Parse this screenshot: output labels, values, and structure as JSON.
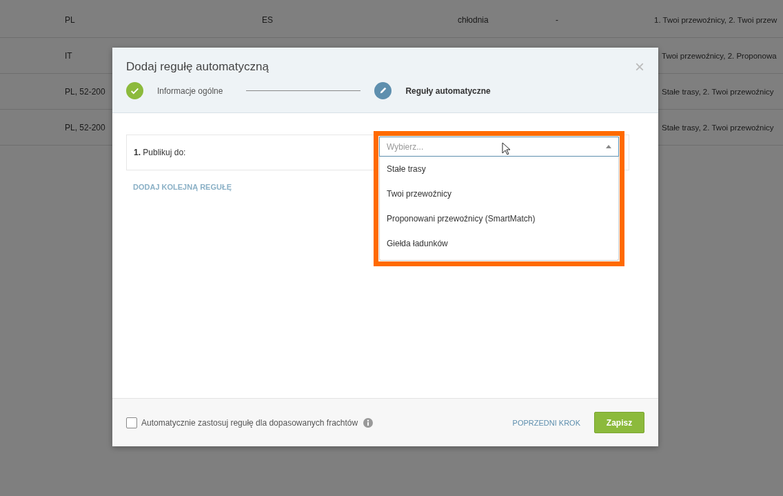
{
  "background_table": {
    "rows": [
      {
        "column_1": "PL",
        "column_2": "ES",
        "column_3": "chłodnia",
        "column_4": "-",
        "column_5": "1. Twoi przewoźnicy, 2. Twoi przew"
      },
      {
        "column_1": "IT",
        "column_5": "Twoi przewoźnicy, 2. Proponowa"
      },
      {
        "column_1": "PL, 52-200",
        "column_5": "Stałe trasy, 2. Twoi przewoźnicy"
      },
      {
        "column_1": "PL, 52-200",
        "column_5": "Stałe trasy, 2. Twoi przewoźnicy"
      }
    ]
  },
  "dialog": {
    "title": "Dodaj regułę automatyczną",
    "close": "×",
    "steps": [
      {
        "label": "Informacje ogólne",
        "kind": "done",
        "selected": false
      },
      {
        "label": "Reguły automatyczne",
        "kind": "current",
        "selected": true
      }
    ],
    "rules": [
      {
        "label": "**1.** Publikuj do:",
        "select": {
          "placeholder": "Wybierz...",
          "expanded": true,
          "highlighted": true,
          "options": [
            "Stałe trasy",
            "Twoi przewoźnicy",
            "Proponowani przewoźnicy (SmartMatch)",
            "Giełda ładunków"
          ]
        }
      }
    ],
    "add_rule": "DODAJ KOLEJNĄ REGUŁĘ",
    "footer": {
      "checkbox": {
        "label": "Automatycznie zastosuj regułę dla dopasowanych frachtów",
        "checked": false
      },
      "back": "POPRZEDNI KROK",
      "save": "Zapisz"
    }
  }
}
